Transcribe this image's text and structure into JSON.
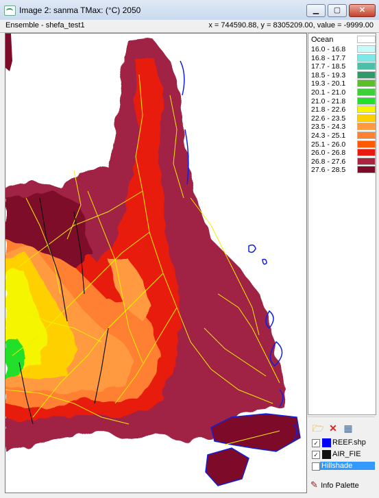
{
  "window": {
    "title": "Image 2: sanma  TMax: (°C) 2050",
    "buttons": {
      "minimize": "▁",
      "maximize": "▢",
      "close": "✕"
    }
  },
  "infobar": {
    "ensemble": "Ensemble - shefa_test1",
    "coords": "x = 744590.88, y = 8305209.00, value = -9999.00"
  },
  "legend": {
    "title": "Ocean",
    "ocean_color": "#ffffff",
    "items": [
      {
        "label": "16.0 - 16.8",
        "color": "#c8fafa"
      },
      {
        "label": "16.8 - 17.7",
        "color": "#7ee8e8"
      },
      {
        "label": "17.7 - 18.5",
        "color": "#4dbfa8"
      },
      {
        "label": "18.5 - 19.3",
        "color": "#2e9a6a"
      },
      {
        "label": "19.3 - 20.1",
        "color": "#5bbf2a"
      },
      {
        "label": "20.1 - 21.0",
        "color": "#3ecf3a"
      },
      {
        "label": "21.0 - 21.8",
        "color": "#22e02a"
      },
      {
        "label": "21.8 - 22.6",
        "color": "#f5f500"
      },
      {
        "label": "22.6 - 23.5",
        "color": "#ffd000"
      },
      {
        "label": "23.5 - 24.3",
        "color": "#ff9a40"
      },
      {
        "label": "24.3 - 25.1",
        "color": "#ff8030"
      },
      {
        "label": "25.1 - 26.0",
        "color": "#ff5a00"
      },
      {
        "label": "26.0 - 26.8",
        "color": "#e81a10"
      },
      {
        "label": "26.8 - 27.6",
        "color": "#a82440"
      },
      {
        "label": "27.6 - 28.5",
        "color": "#7e0a2a"
      }
    ]
  },
  "layers": [
    {
      "name": "REEF.shp",
      "checked": true,
      "color": "#0000ff"
    },
    {
      "name": "AIR_FIE",
      "checked": true,
      "color": "#111111"
    },
    {
      "name": "Hillshade",
      "checked": false,
      "selected": true
    }
  ],
  "footer": {
    "info_palette": "Info Palette",
    "icon": "pencil-icon"
  },
  "toolbar_icons": [
    "folder-open-icon",
    "delete-icon",
    "table-icon"
  ]
}
